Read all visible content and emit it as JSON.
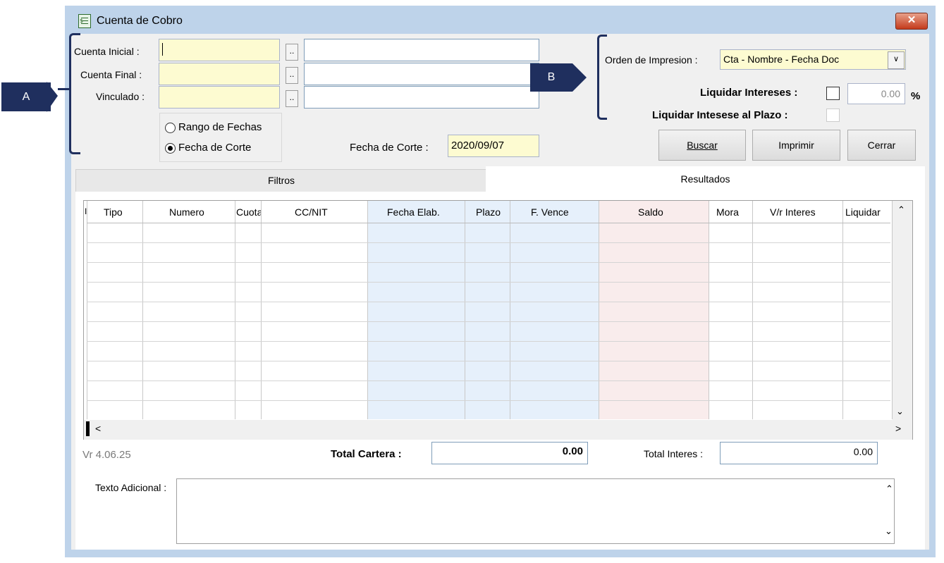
{
  "window": {
    "title": "Cuenta de Cobro",
    "close_label": "✕"
  },
  "fields": {
    "cuenta_inicial": {
      "label": "Cuenta Inicial :",
      "value": ""
    },
    "cuenta_final": {
      "label": "Cuenta Final :",
      "value": ""
    },
    "vinculado": {
      "label": "Vinculado :",
      "value": ""
    },
    "lookup_label": ".."
  },
  "date_mode": {
    "rango": "Rango de Fechas",
    "corte": "Fecha de Corte",
    "selected": "corte"
  },
  "fecha_corte": {
    "label": "Fecha de Corte :",
    "value": "2020/09/07"
  },
  "orden": {
    "label": "Orden de Impresion :",
    "value": "Cta - Nombre - Fecha Doc"
  },
  "liquidar_intereses": {
    "label": "Liquidar Intereses :",
    "rate": "0.00",
    "unit": "%"
  },
  "liquidar_plazo": {
    "label": "Liquidar Intesese al Plazo :"
  },
  "buttons": {
    "buscar": "Buscar",
    "imprimir": "Imprimir",
    "cerrar": "Cerrar"
  },
  "tabs": {
    "filtros": "Filtros",
    "resultados": "Resultados"
  },
  "table": {
    "columns": [
      "I",
      "Tipo",
      "Numero",
      "Cuota",
      "CC/NIT",
      "Fecha Elab.",
      "Plazo",
      "F. Vence",
      "Saldo",
      "Mora",
      "V/r Interes",
      "Liquidar"
    ]
  },
  "version": "Vr 4.06.25",
  "total_cartera": {
    "label": "Total  Cartera :",
    "value": "0.00"
  },
  "total_interes": {
    "label": "Total Interes :",
    "value": "0.00"
  },
  "texto_adicional": {
    "label": "Texto Adicional :"
  },
  "callouts": {
    "a": "A",
    "b": "B"
  },
  "colors": {
    "window_frame": "#bed3ea",
    "input_yellow": "#fdfbd1",
    "callout": "#1f2f5e",
    "col_blue": "#e6f0fb",
    "col_pink": "#f9ecec"
  }
}
